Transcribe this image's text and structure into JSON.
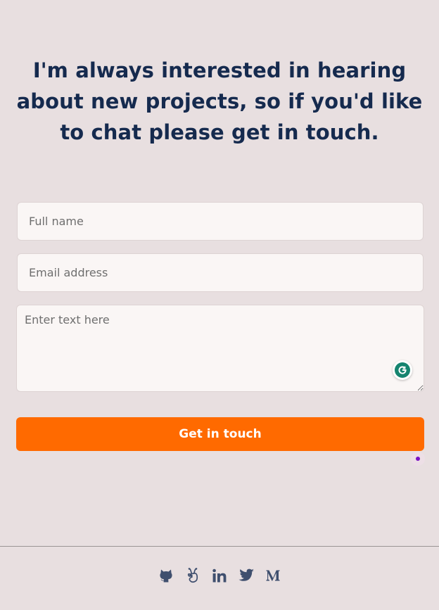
{
  "contact": {
    "headline": "I'm always interested in hearing about new projects, so if you'd like to chat please get in touch.",
    "name_placeholder": "Full name",
    "email_placeholder": "Email address",
    "message_placeholder": "Enter text here",
    "submit_label": "Get in touch"
  },
  "footer": {
    "social": [
      "github-icon",
      "angellist-icon",
      "linkedin-icon",
      "twitter-icon",
      "medium-icon"
    ]
  },
  "colors": {
    "background": "#e8dfe0",
    "headline": "#152a4e",
    "accent": "#ff6a00",
    "field_background": "#faf6f5",
    "icon": "#3f4f6e"
  }
}
